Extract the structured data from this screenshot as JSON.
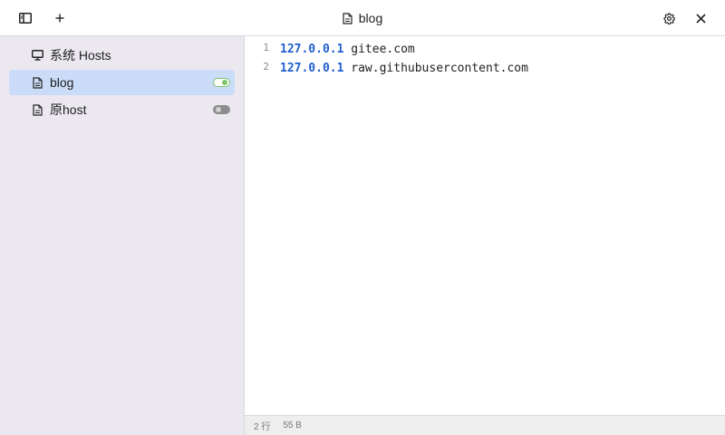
{
  "toolbar": {
    "title": "blog",
    "title_icon": "file-text-icon",
    "left_buttons": [
      "sidebar-toggle-icon",
      "plus-icon"
    ],
    "right_buttons": [
      "gear-icon",
      "close-icon"
    ]
  },
  "sidebar": {
    "items": [
      {
        "label": "系统 Hosts",
        "icon": "monitor-icon",
        "active": false,
        "toggle": null
      },
      {
        "label": "blog",
        "icon": "file-text-icon",
        "active": true,
        "toggle": "on"
      },
      {
        "label": "原host",
        "icon": "file-text-icon",
        "active": false,
        "toggle": "off"
      }
    ]
  },
  "editor": {
    "lines": [
      {
        "number": "1",
        "ip": "127.0.0.1",
        "host": " gitee.com"
      },
      {
        "number": "2",
        "ip": "127.0.0.1",
        "host": " raw.githubusercontent.com"
      }
    ]
  },
  "status": {
    "lines": "2 行",
    "size": "55 B"
  },
  "colors": {
    "sidebar_bg": "#ebe8ef",
    "active_item_bg": "#cadcf7",
    "toggle_on": "#7cc36a",
    "ip_color": "#1f5fcf"
  }
}
